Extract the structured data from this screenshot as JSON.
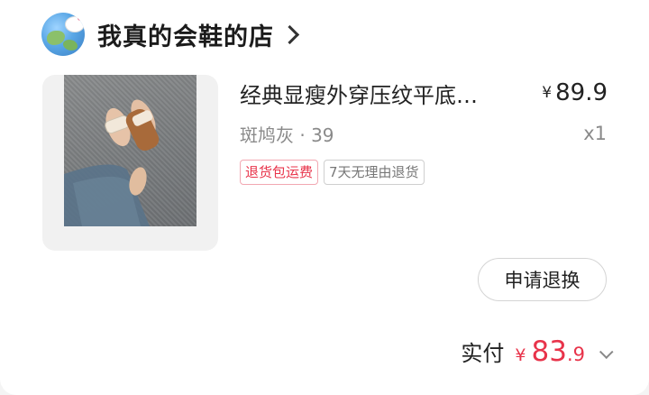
{
  "shop": {
    "name": "我真的会鞋的店",
    "avatar_icon": "hello-kitty-globe-avatar",
    "nav_icon": "chevron-right-icon"
  },
  "product": {
    "title": "经典显瘦外穿压纹平底…",
    "price_symbol": "¥",
    "price": "89.9",
    "sku": "斑鸠灰 · 39",
    "quantity": "x1",
    "tags": [
      "退货包运费",
      "7天无理由退货"
    ]
  },
  "actions": {
    "exchange_label": "申请退换"
  },
  "total": {
    "label": "实付",
    "symbol": "¥",
    "integer": "83",
    "decimal": ".9",
    "expand_icon": "chevron-down-icon"
  },
  "colors": {
    "accent": "#e8334a",
    "muted_text": "#8a8a8a"
  }
}
